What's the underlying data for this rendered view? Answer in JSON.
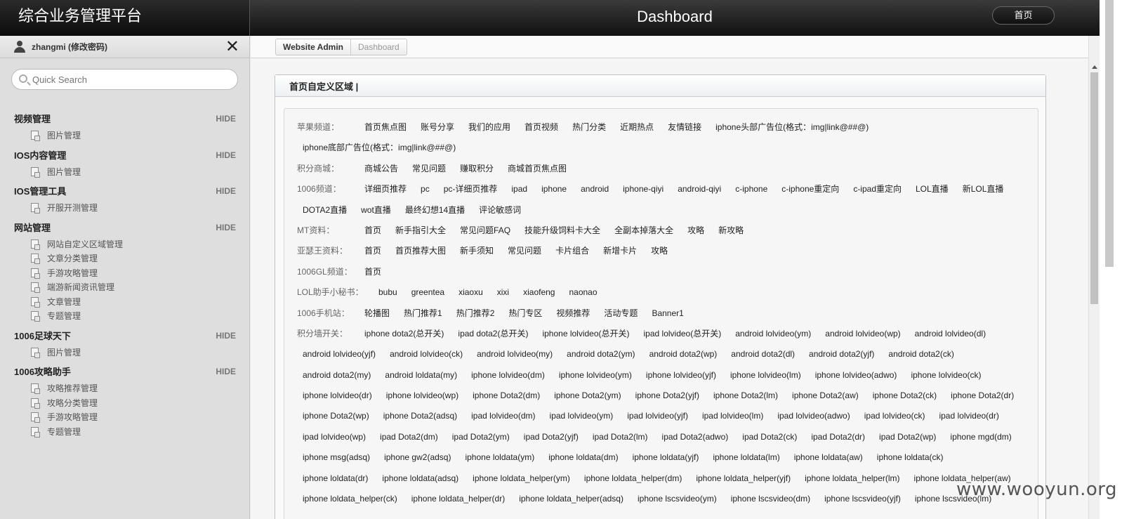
{
  "app": {
    "title": "综合业务管理平台",
    "page_heading": "Dashboard",
    "home_button": "首页"
  },
  "user": {
    "name": "zhangmi (修改密码)"
  },
  "search": {
    "placeholder": "Quick Search"
  },
  "sidebar": {
    "hide_label": "HIDE",
    "groups": [
      {
        "title": "视频管理",
        "items": [
          "图片管理"
        ]
      },
      {
        "title": "IOS内容管理",
        "items": [
          "图片管理"
        ]
      },
      {
        "title": "IOS管理工具",
        "items": [
          "开服开测管理"
        ]
      },
      {
        "title": "网站管理",
        "items": [
          "网站自定义区域管理",
          "文章分类管理",
          "手游攻略管理",
          "端游新闻资讯管理",
          "文章管理",
          "专题管理"
        ]
      },
      {
        "title": "1006足球天下",
        "items": [
          "图片管理"
        ]
      },
      {
        "title": "1006攻略助手",
        "items": [
          "攻略推荐管理",
          "攻略分类管理",
          "手游攻略管理",
          "专题管理"
        ]
      }
    ]
  },
  "breadcrumb": {
    "root": "Website Admin",
    "current": "Dashboard"
  },
  "panel": {
    "title": "首页自定义区域 |",
    "rows": [
      {
        "label": "苹果频道：",
        "links": [
          "首页焦点图",
          "账号分享",
          "我们的应用",
          "首页视频",
          "热门分类",
          "近期热点",
          "友情链接",
          "iphone头部广告位(格式：img|link@##@)",
          "iphone底部广告位(格式：img|link@##@)"
        ]
      },
      {
        "label": "积分商城：",
        "links": [
          "商城公告",
          "常见问题",
          "赚取积分",
          "商城首页焦点图"
        ]
      },
      {
        "label": "1006频道：",
        "links": [
          "详细页推荐",
          "pc",
          "pc-详细页推荐",
          "ipad",
          "iphone",
          "android",
          "iphone-qiyi",
          "android-qiyi",
          "c-iphone",
          "c-iphone重定向",
          "c-ipad重定向",
          "LOL直播",
          "新LOL直播",
          "DOTA2直播",
          "wot直播",
          "最终幻想14直播",
          "评论敏感词"
        ]
      },
      {
        "label": "MT资料：",
        "links": [
          "首页",
          "新手指引大全",
          "常见问题FAQ",
          "技能升级饲料卡大全",
          "全副本掉落大全",
          "攻略",
          "新攻略"
        ]
      },
      {
        "label": "亚瑟王资料：",
        "links": [
          "首页",
          "首页推荐大图",
          "新手须知",
          "常见问题",
          "卡片组合",
          "新增卡片",
          "攻略"
        ]
      },
      {
        "label": "1006GL频道：",
        "links": [
          "首页"
        ]
      },
      {
        "label": "LOL助手小秘书：",
        "wide": true,
        "links": [
          "bubu",
          "greentea",
          "xiaoxu",
          "xixi",
          "xiaofeng",
          "naonao"
        ]
      },
      {
        "label": "1006手机站：",
        "links": [
          "轮播图",
          "热门推荐1",
          "热门推荐2",
          "热门专区",
          "视频推荐",
          "活动专题",
          "Banner1"
        ]
      },
      {
        "label": "积分墙开关：",
        "links": [
          "iphone dota2(总开关)",
          "ipad dota2(总开关)",
          "iphone lolvideo(总开关)",
          "ipad lolvideo(总开关)",
          "android lolvideo(ym)",
          "android lolvideo(wp)",
          "android lolvideo(dl)",
          "android lolvideo(yjf)",
          "android lolvideo(ck)",
          "android lolvideo(my)",
          "android dota2(ym)",
          "android dota2(wp)",
          "android dota2(dl)",
          "android dota2(yjf)",
          "android dota2(ck)",
          "android dota2(my)",
          "android loldata(my)",
          "iphone lolvideo(dm)",
          "iphone lolvideo(ym)",
          "iphone lolvideo(yjf)",
          "iphone lolvideo(lm)",
          "iphone lolvideo(adwo)",
          "iphone lolvideo(ck)",
          "iphone lolvideo(dr)",
          "iphone lolvideo(wp)",
          "iphone Dota2(dm)",
          "iphone Dota2(ym)",
          "iphone Dota2(yjf)",
          "iphone Dota2(lm)",
          "iphone Dota2(aw)",
          "iphone Dota2(ck)",
          "iphone Dota2(dr)",
          "iphone Dota2(wp)",
          "iphone Dota2(adsq)",
          "ipad lolvideo(dm)",
          "ipad lolvideo(ym)",
          "ipad lolvideo(yjf)",
          "ipad lolvideo(lm)",
          "ipad lolvideo(adwo)",
          "ipad lolvideo(ck)",
          "ipad lolvideo(dr)",
          "ipad lolvideo(wp)",
          "ipad Dota2(dm)",
          "ipad Dota2(ym)",
          "ipad Dota2(yjf)",
          "ipad Dota2(lm)",
          "ipad Dota2(adwo)",
          "ipad Dota2(ck)",
          "ipad Dota2(dr)",
          "ipad Dota2(wp)",
          "iphone mgd(dm)",
          "iphone msg(adsq)",
          "iphone gw2(adsq)",
          "iphone loldata(ym)",
          "iphone loldata(dm)",
          "iphone loldata(yjf)",
          "iphone loldata(lm)",
          "iphone loldata(aw)",
          "iphone loldata(ck)",
          "iphone loldata(dr)",
          "iphone loldata(adsq)",
          "iphone loldata_helper(ym)",
          "iphone loldata_helper(dm)",
          "iphone loldata_helper(yjf)",
          "iphone loldata_helper(lm)",
          "iphone loldata_helper(aw)",
          "iphone loldata_helper(ck)",
          "iphone loldata_helper(dr)",
          "iphone loldata_helper(adsq)",
          "iphone lscsvideo(ym)",
          "iphone lscsvideo(dm)",
          "iphone lscsvideo(yjf)",
          "iphone lscsvideo(lm)"
        ]
      }
    ]
  },
  "watermark": "www.wooyun.org"
}
